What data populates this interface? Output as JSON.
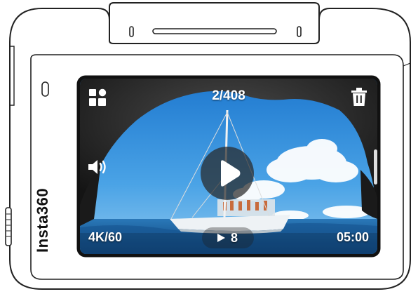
{
  "device": {
    "brand": "Insta360"
  },
  "playback": {
    "counter": "2/408",
    "resolution": "4K/60",
    "play_count": "8",
    "duration": "05:00"
  },
  "icons": {
    "gallery": "grid-icon",
    "delete": "trash-icon",
    "volume": "speaker-icon",
    "play": "play-icon",
    "views": "play-small-icon"
  },
  "colors": {
    "overlay_text": "#ffffff",
    "play_button_bg": "#282828",
    "sky": "#2f8fdb",
    "sea": "#1d5f9e",
    "cave_rock": "#1b1b1b"
  }
}
